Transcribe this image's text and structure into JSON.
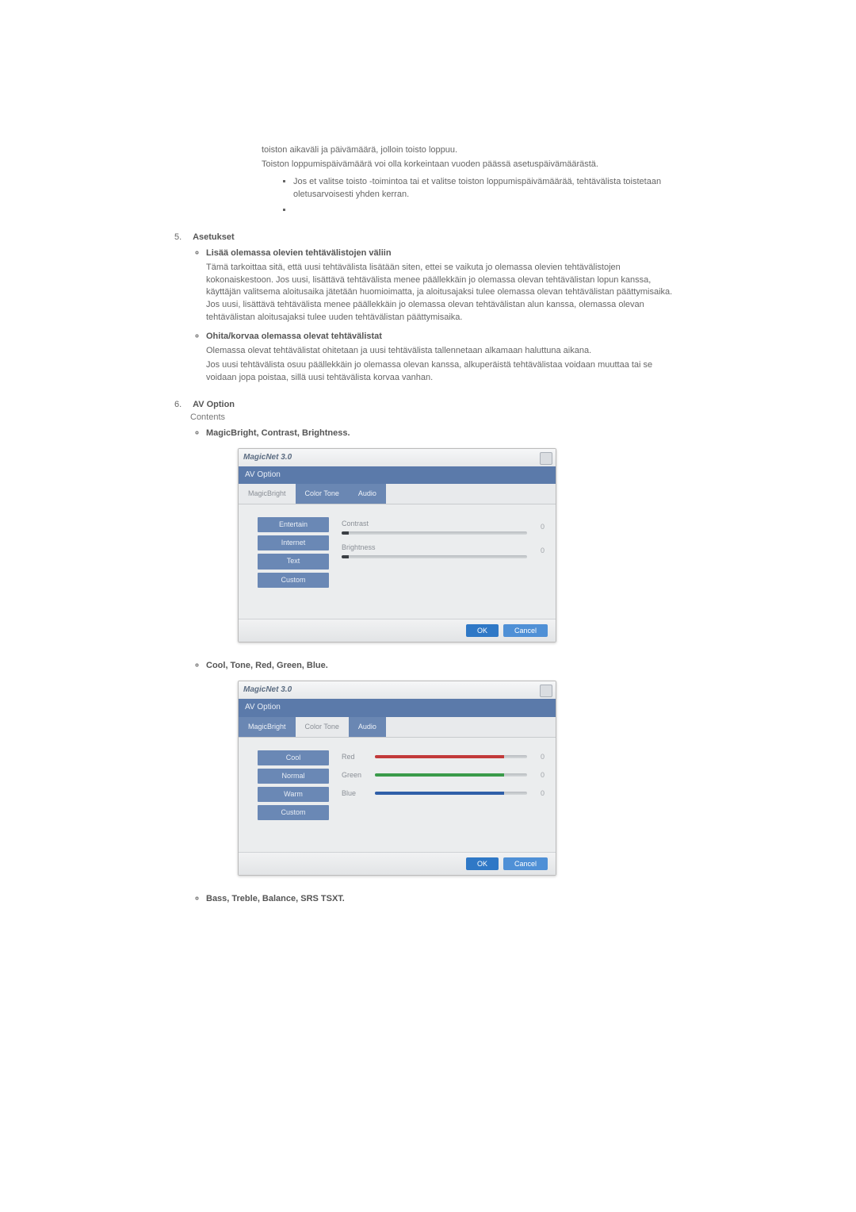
{
  "intro": {
    "line1": "toiston aikaväli ja päivämäärä, jolloin toisto loppuu.",
    "line2": "Toiston loppumispäivämäärä voi olla korkeintaan vuoden päässä asetuspäivämäärästä.",
    "bullet": "Jos et valitse toisto -toimintoa tai et valitse toiston loppumispäivämäärää, tehtävälista toistetaan oletusarvoisesti yhden kerran."
  },
  "section5": {
    "num": "5.",
    "title": "Asetukset",
    "items": [
      {
        "lead": "Lisää olemassa olevien tehtävälistojen väliin",
        "body": "Tämä tarkoittaa sitä, että uusi tehtävälista lisätään siten, ettei se vaikuta jo olemassa olevien tehtävälistojen kokonaiskestoon. Jos uusi, lisättävä tehtävälista menee päällekkäin jo olemassa olevan tehtävälistan lopun kanssa, käyttäjän valitsema aloitusaika jätetään huomioimatta, ja aloitusajaksi tulee olemassa olevan tehtävälistan päättymisaika. Jos uusi, lisättävä tehtävälista menee päällekkäin jo olemassa olevan tehtävälistan alun kanssa, olemassa olevan tehtävälistan aloitusajaksi tulee uuden tehtävälistan päättymisaika."
      },
      {
        "lead": "Ohita/korvaa olemassa olevat tehtävälistat",
        "body": "Olemassa olevat tehtävälistat ohitetaan ja uusi tehtävälista tallennetaan alkamaan haluttuna aikana.",
        "body2": "Jos uusi tehtävälista osuu päällekkäin jo olemassa olevan kanssa, alkuperäistä tehtävälistaa voidaan muuttaa tai se voidaan jopa poistaa, sillä uusi tehtävälista korvaa vanhan."
      }
    ]
  },
  "section6": {
    "num": "6.",
    "title": "AV Option",
    "subtitle": "Contents",
    "entries": [
      {
        "lead": "MagicBright, Contrast, Brightness."
      },
      {
        "lead": "Cool, Tone, Red, Green, Blue."
      },
      {
        "lead": "Bass, Treble, Balance, SRS TSXT."
      }
    ]
  },
  "dialog": {
    "title": "MagicNet 3.0",
    "subtitle": "AV Option",
    "tabs": [
      "MagicBright",
      "Color Tone",
      "Audio"
    ],
    "ok": "OK",
    "cancel": "Cancel"
  },
  "dialog1": {
    "presets": [
      "Entertain",
      "Internet",
      "Text",
      "Custom"
    ],
    "sliders": [
      {
        "label": "Contrast",
        "value": "0"
      },
      {
        "label": "Brightness",
        "value": "0"
      }
    ]
  },
  "dialog2": {
    "presets": [
      "Cool",
      "Normal",
      "Warm",
      "Custom"
    ],
    "sliders": [
      {
        "label": "Red",
        "value": "0"
      },
      {
        "label": "Green",
        "value": "0"
      },
      {
        "label": "Blue",
        "value": "0"
      }
    ]
  },
  "chart_data": [
    {
      "type": "bar",
      "title": "AV Option — MagicBright sliders",
      "categories": [
        "Contrast",
        "Brightness"
      ],
      "values": [
        0,
        0
      ],
      "xlabel": "",
      "ylabel": "",
      "ylim": [
        0,
        100
      ]
    },
    {
      "type": "bar",
      "title": "AV Option — Color Tone RGB sliders",
      "categories": [
        "Red",
        "Green",
        "Blue"
      ],
      "values": [
        0,
        0,
        0
      ],
      "xlabel": "",
      "ylabel": "",
      "ylim": [
        0,
        100
      ]
    }
  ]
}
